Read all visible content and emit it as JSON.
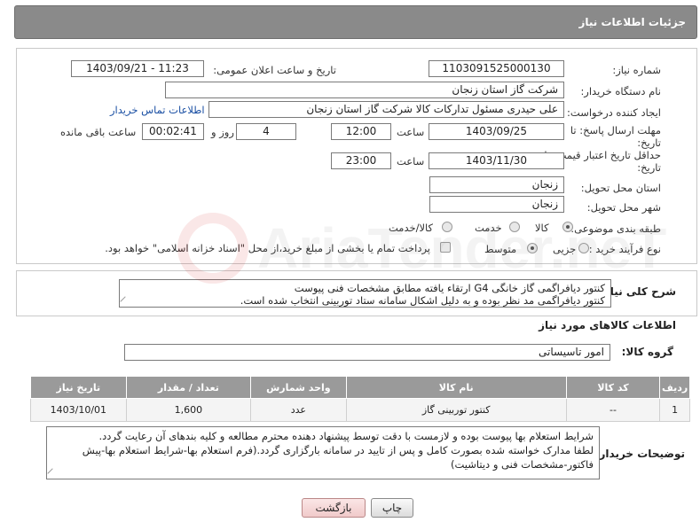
{
  "header": {
    "title": "جزئیات اطلاعات نیاز"
  },
  "need": {
    "number_label": "شماره نیاز:",
    "number_value": "1103091525000130",
    "announce_label": "تاریخ و ساعت اعلان عمومی:",
    "announce_value": "1403/09/21 - 11:23",
    "buyer_label": "نام دستگاه خریدار:",
    "buyer_value": "شرکت گاز استان زنجان",
    "requester_label": "ایجاد کننده درخواست:",
    "requester_value": "علی حیدری مسئول تدارکات کالا شرکت گاز استان زنجان",
    "contact_link": "اطلاعات تماس خریدار",
    "deadline_label": "مهلت ارسال پاسخ: تا تاریخ:",
    "deadline_date": "1403/09/25",
    "time_word": "ساعت",
    "deadline_time": "12:00",
    "days_value": "4",
    "days_word": "روز و",
    "remaining_value": "00:02:41",
    "remaining_word": "ساعت باقی مانده",
    "validity_label": "حداقل تاریخ اعتبار قیمت: تا تاریخ:",
    "validity_date": "1403/11/30",
    "validity_time": "23:00",
    "province_label": "استان محل تحویل:",
    "province_value": "زنجان",
    "city_label": "شهر محل تحویل:",
    "city_value": "زنجان",
    "category_label": "طبقه بندی موضوعی:",
    "category_options": [
      "کالا",
      "خدمت",
      "کالا/خدمت"
    ],
    "category_selected": "کالا",
    "process_label": "نوع فرآیند خرید :",
    "process_options": [
      "جزیی",
      "متوسط"
    ],
    "process_selected": "متوسط",
    "payment_note": "پرداخت تمام یا بخشی از مبلغ خرید،از محل \"اسناد خزانه اسلامی\" خواهد بود."
  },
  "summary": {
    "label": "شرح کلی نیاز:",
    "line1": "کنتور دیافراگمی گاز خانگی G4 ارتقاء یافته مطابق مشخصات فنی پیوست",
    "line2": "کنتور دیافراگمی مد نظر بوده و به دلیل اشکال سامانه ستاد توربینی انتخاب شده است."
  },
  "goods": {
    "section_title": "اطلاعات کالاهای مورد نیاز",
    "group_label": "گروه کالا:",
    "group_value": "امور تاسیساتی",
    "columns": [
      "ردیف",
      "کد کالا",
      "نام کالا",
      "واحد شمارش",
      "تعداد / مقدار",
      "تاریخ نیاز"
    ],
    "rows": [
      {
        "row": "1",
        "code": "--",
        "name": "کنتور توربینی گاز",
        "unit": "عدد",
        "qty": "1,600",
        "date": "1403/10/01"
      }
    ]
  },
  "buyer_notes": {
    "label": "توضیحات خریدار:",
    "line1": "شرایط استعلام بها پیوست بوده و لازمست با دقت توسط پیشنهاد دهنده محترم مطالعه و کلیه بندهای آن رعایت گردد.",
    "line2": "لطفا مدارک خواسته شده بصورت کامل و پس از تایید در سامانه بارگزاری گردد.(فرم استعلام بها-شرایط استعلام بها-پیش",
    "line3": "فاکتور-مشخصات فنی و دیتاشیت)"
  },
  "buttons": {
    "print": "چاپ",
    "back": "بازگشت"
  },
  "watermark_text": "AriaTender.neT"
}
